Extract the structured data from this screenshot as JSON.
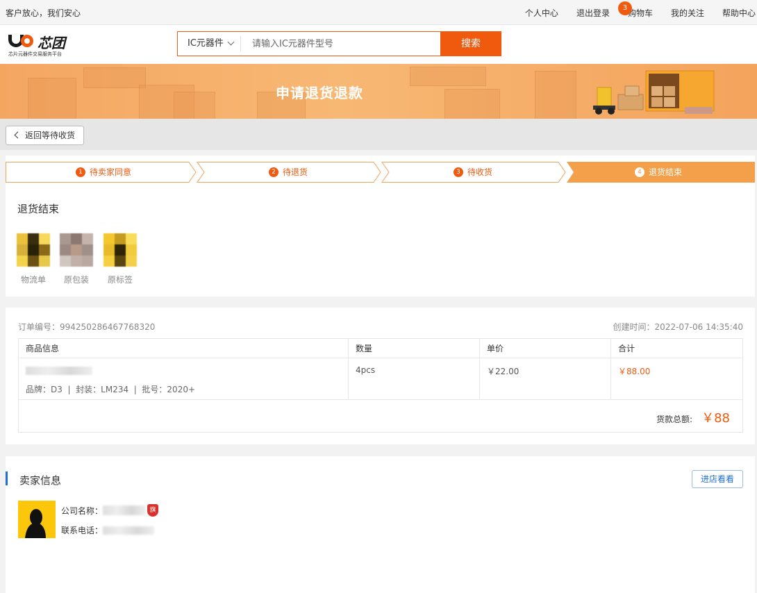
{
  "topbar": {
    "slogan": "客户放心，我们安心",
    "links": {
      "personal": "个人中心",
      "logout": "退出登录",
      "cart": "购物车",
      "cart_count": "3",
      "follow": "我的关注",
      "help": "帮助中心"
    }
  },
  "header": {
    "logo_name": "芯团",
    "logo_sub": "芯片元器件交易服务平台",
    "search": {
      "category": "IC元器件",
      "placeholder": "请输入IC元器件型号",
      "button": "搜索"
    }
  },
  "banner": {
    "title": "申请退货退款"
  },
  "back": {
    "label": "返回等待收货"
  },
  "steps": [
    {
      "num": "1",
      "label": "待卖家同意",
      "active": false
    },
    {
      "num": "2",
      "label": "待退货",
      "active": false
    },
    {
      "num": "3",
      "label": "待收货",
      "active": false
    },
    {
      "num": "4",
      "label": "退货结束",
      "active": true
    }
  ],
  "status": {
    "title": "退货结束",
    "proofs": [
      "物流单",
      "原包装",
      "原标签"
    ]
  },
  "order": {
    "no_label": "订单编号：",
    "no": "994250286467768320",
    "created_label": "创建时间：",
    "created": "2022-07-06 14:35:40",
    "columns": [
      "商品信息",
      "数量",
      "单价",
      "合计"
    ],
    "item": {
      "meta": "品牌：D3  |  封装：LM234  |  批号：2020+",
      "qty": "4pcs",
      "price": "￥22.00",
      "subtotal": "￥88.00"
    },
    "total_label": "货款总额:",
    "total": "￥88"
  },
  "seller": {
    "title": "卖家信息",
    "shop_button": "进店看看",
    "company_label": "公司名称：",
    "flag": "旗",
    "phone_label": "联系电话："
  },
  "colors": {
    "accent": "#ef5a0f",
    "step_active": "#f4a04a",
    "link_blue": "#1f6fd6"
  }
}
